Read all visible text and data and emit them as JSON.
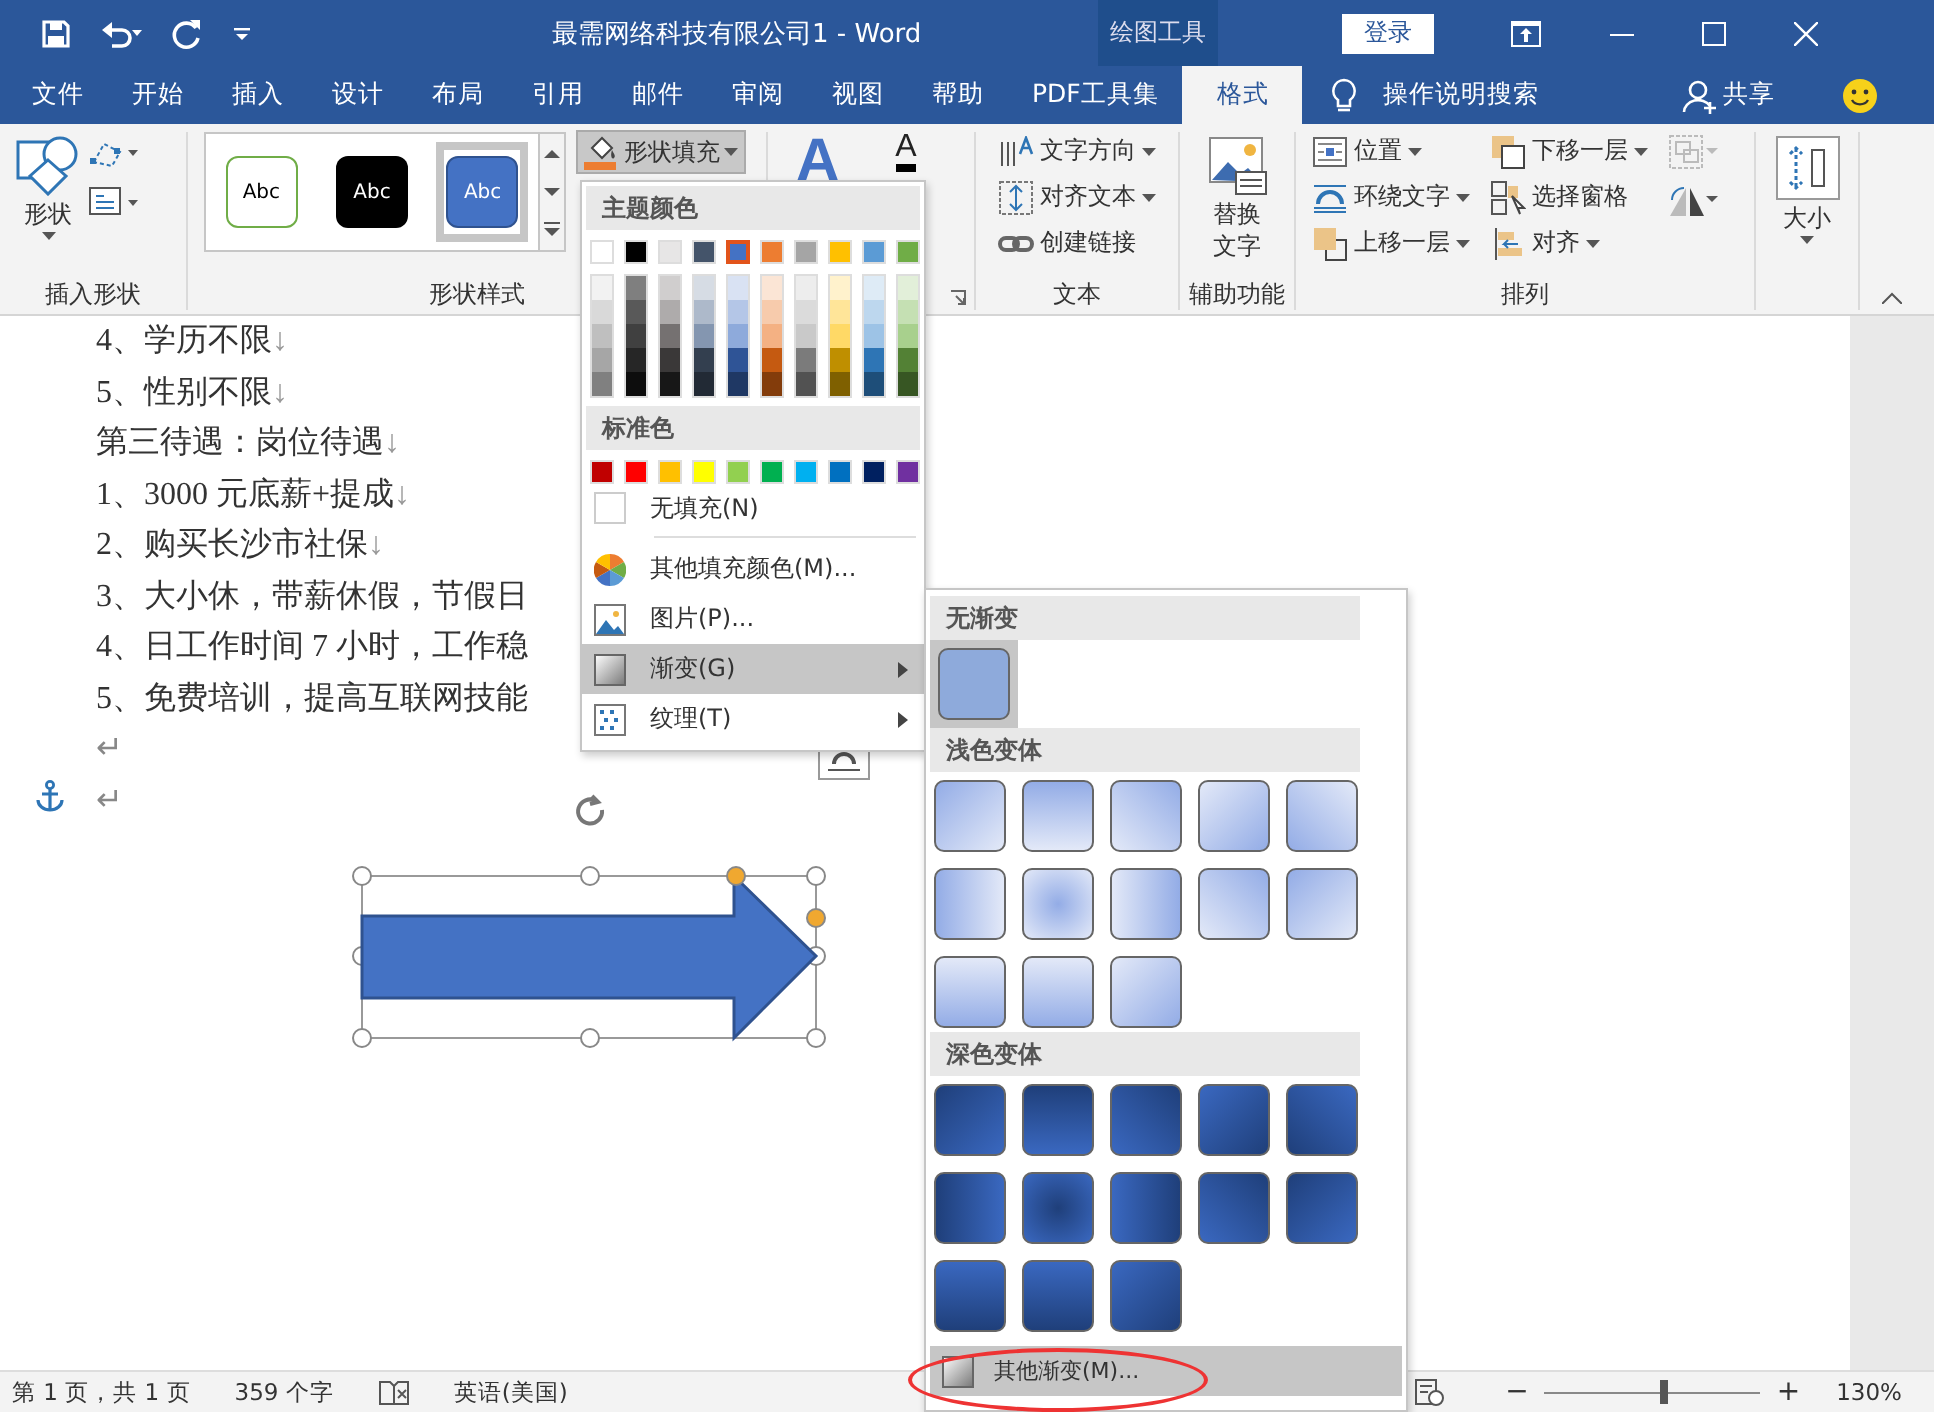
{
  "title_bar": {
    "title": "最需网络科技有限公司1  -  Word",
    "contextual_tab": "绘图工具",
    "sign_in": "登录"
  },
  "tabs": [
    {
      "label": "文件",
      "selected": false
    },
    {
      "label": "开始",
      "selected": false
    },
    {
      "label": "插入",
      "selected": false
    },
    {
      "label": "设计",
      "selected": false
    },
    {
      "label": "布局",
      "selected": false
    },
    {
      "label": "引用",
      "selected": false
    },
    {
      "label": "邮件",
      "selected": false
    },
    {
      "label": "审阅",
      "selected": false
    },
    {
      "label": "视图",
      "selected": false
    },
    {
      "label": "帮助",
      "selected": false
    },
    {
      "label": "PDF工具集",
      "selected": false
    },
    {
      "label": "格式",
      "selected": true
    }
  ],
  "tell_me": "操作说明搜索",
  "share": "共享",
  "ribbon": {
    "insert_shapes": {
      "shapes_label": "形状",
      "group_label": "插入形状"
    },
    "shape_styles": {
      "styles": [
        {
          "label": "Abc",
          "selected": false
        },
        {
          "label": "Abc",
          "selected": false
        },
        {
          "label": "Abc",
          "selected": true
        }
      ],
      "fill_button": {
        "label": "形状填充",
        "pressed": true
      },
      "group_label": "形状样式"
    },
    "wordart": {
      "glyphs": [
        "A",
        "A"
      ]
    },
    "text": {
      "items": [
        {
          "label": "文字方向",
          "dropdown": true
        },
        {
          "label": "对齐文本",
          "dropdown": true
        },
        {
          "label": "创建链接",
          "dropdown": false
        }
      ],
      "group_label": "文本"
    },
    "accessibility": {
      "lines": [
        "替换",
        "文字"
      ],
      "group_label": "辅助功能"
    },
    "arrange": {
      "column_1": [
        {
          "label": "位置",
          "dropdown": true
        },
        {
          "label": "环绕文字",
          "dropdown": true
        },
        {
          "label": "上移一层",
          "dropdown": true
        }
      ],
      "column_2": [
        {
          "label": "下移一层",
          "dropdown": true
        },
        {
          "label": "选择窗格",
          "dropdown": false
        },
        {
          "label": "对齐",
          "dropdown": true
        }
      ],
      "group_label": "排列"
    },
    "size": {
      "label": "大小"
    }
  },
  "document": {
    "lines": [
      {
        "text": "4、学历不限",
        "mark": "↓"
      },
      {
        "text": "5、性别不限",
        "mark": "↓"
      },
      {
        "text": "第三待遇：岗位待遇",
        "mark": "↓"
      },
      {
        "text": "1、3000 元底薪+提成",
        "mark": "↓"
      },
      {
        "text": "2、购买长沙市社保",
        "mark": "↓"
      },
      {
        "text": "3、大小休，带薪休假，节假日"
      },
      {
        "text": "4、日工作时间 7 小时，工作稳"
      },
      {
        "text": "5、免费培训，提高互联网技能"
      },
      {
        "text": "↵"
      },
      {
        "text": "↵"
      }
    ]
  },
  "fill_menu": {
    "theme_header": "主题颜色",
    "theme_colors": [
      {
        "color": "#ffffff",
        "selected": false,
        "shades": [
          {
            "color": "#f2f2f2"
          },
          {
            "color": "#d9d9d9"
          },
          {
            "color": "#bfbfbf"
          },
          {
            "color": "#a6a6a6"
          },
          {
            "color": "#808080"
          }
        ]
      },
      {
        "color": "#000000",
        "selected": false,
        "shades": [
          {
            "color": "#7f7f7f"
          },
          {
            "color": "#595959"
          },
          {
            "color": "#404040"
          },
          {
            "color": "#262626"
          },
          {
            "color": "#0d0d0d"
          }
        ]
      },
      {
        "color": "#e7e6e6",
        "selected": false,
        "shades": [
          {
            "color": "#d0cece"
          },
          {
            "color": "#aeabab"
          },
          {
            "color": "#757171"
          },
          {
            "color": "#3a3838"
          },
          {
            "color": "#171717"
          }
        ]
      },
      {
        "color": "#44546a",
        "selected": false,
        "shades": [
          {
            "color": "#d6dce4"
          },
          {
            "color": "#adb9ca"
          },
          {
            "color": "#8496b0"
          },
          {
            "color": "#333f4f"
          },
          {
            "color": "#222a35"
          }
        ]
      },
      {
        "color": "#4472c4",
        "selected": true,
        "shades": [
          {
            "color": "#d9e2f3"
          },
          {
            "color": "#b4c6e7"
          },
          {
            "color": "#8eaadb"
          },
          {
            "color": "#2f5496"
          },
          {
            "color": "#1f3864"
          }
        ]
      },
      {
        "color": "#ed7d31",
        "selected": false,
        "shades": [
          {
            "color": "#fbe5d5"
          },
          {
            "color": "#f7cbac"
          },
          {
            "color": "#f4b183"
          },
          {
            "color": "#c55a11"
          },
          {
            "color": "#833c0b"
          }
        ]
      },
      {
        "color": "#a5a5a5",
        "selected": false,
        "shades": [
          {
            "color": "#ededed"
          },
          {
            "color": "#dbdbdb"
          },
          {
            "color": "#c9c9c9"
          },
          {
            "color": "#7b7b7b"
          },
          {
            "color": "#525252"
          }
        ]
      },
      {
        "color": "#ffc000",
        "selected": false,
        "shades": [
          {
            "color": "#fff2cc"
          },
          {
            "color": "#ffe599"
          },
          {
            "color": "#ffd966"
          },
          {
            "color": "#bf8f00"
          },
          {
            "color": "#7f6000"
          }
        ]
      },
      {
        "color": "#5b9bd5",
        "selected": false,
        "shades": [
          {
            "color": "#deebf6"
          },
          {
            "color": "#bdd7ee"
          },
          {
            "color": "#9dc3e6"
          },
          {
            "color": "#2e75b5"
          },
          {
            "color": "#1e4e79"
          }
        ]
      },
      {
        "color": "#70ad47",
        "selected": false,
        "shades": [
          {
            "color": "#e2efd9"
          },
          {
            "color": "#c5e0b3"
          },
          {
            "color": "#a8d08d"
          },
          {
            "color": "#538135"
          },
          {
            "color": "#375623"
          }
        ]
      }
    ],
    "standard_header": "标准色",
    "standard_colors": [
      {
        "color": "#c00000"
      },
      {
        "color": "#ff0000"
      },
      {
        "color": "#ffc000"
      },
      {
        "color": "#ffff00"
      },
      {
        "color": "#92d050"
      },
      {
        "color": "#00b050"
      },
      {
        "color": "#00b0f0"
      },
      {
        "color": "#0070c0"
      },
      {
        "color": "#002060"
      },
      {
        "color": "#7030a0"
      }
    ],
    "no_fill": "无填充(N)",
    "items": [
      {
        "label": "其他填充颜色(M)...",
        "kind": "colors",
        "highlighted": false,
        "submenu": false
      },
      {
        "label": "图片(P)...",
        "kind": "picture",
        "highlighted": false,
        "submenu": false
      },
      {
        "label": "渐变(G)",
        "kind": "gradient",
        "highlighted": true,
        "submenu": true
      },
      {
        "label": "纹理(T)",
        "kind": "texture",
        "highlighted": false,
        "submenu": true
      }
    ]
  },
  "gradient_menu": {
    "sections": [
      {
        "title": "无渐变",
        "kind": "none",
        "swatches": [
          {
            "selected": true
          }
        ]
      },
      {
        "title": "浅色变体",
        "kind": "light",
        "swatches": [
          {
            "selected": false
          },
          {
            "selected": false
          },
          {
            "selected": false
          },
          {
            "selected": false
          },
          {
            "selected": false
          },
          {
            "selected": false
          },
          {
            "selected": false
          },
          {
            "selected": false
          },
          {
            "selected": false
          },
          {
            "selected": false
          },
          {
            "selected": false
          },
          {
            "selected": false
          },
          {
            "selected": false
          }
        ]
      },
      {
        "title": "深色变体",
        "kind": "dark",
        "swatches": [
          {
            "selected": false
          },
          {
            "selected": false
          },
          {
            "selected": false
          },
          {
            "selected": false
          },
          {
            "selected": false
          },
          {
            "selected": false
          },
          {
            "selected": false
          },
          {
            "selected": false
          },
          {
            "selected": false
          },
          {
            "selected": false
          },
          {
            "selected": false
          },
          {
            "selected": false
          },
          {
            "selected": false
          }
        ]
      }
    ],
    "more": {
      "label": "其他渐变(M)...",
      "highlighted": true
    }
  },
  "status_bar": {
    "page": "第 1 页，共 1 页",
    "words": "359 个字",
    "language": "英语(美国)",
    "zoom_out": "−",
    "zoom_in": "+",
    "zoom": {
      "level": 0.55,
      "reading": "130%"
    }
  }
}
